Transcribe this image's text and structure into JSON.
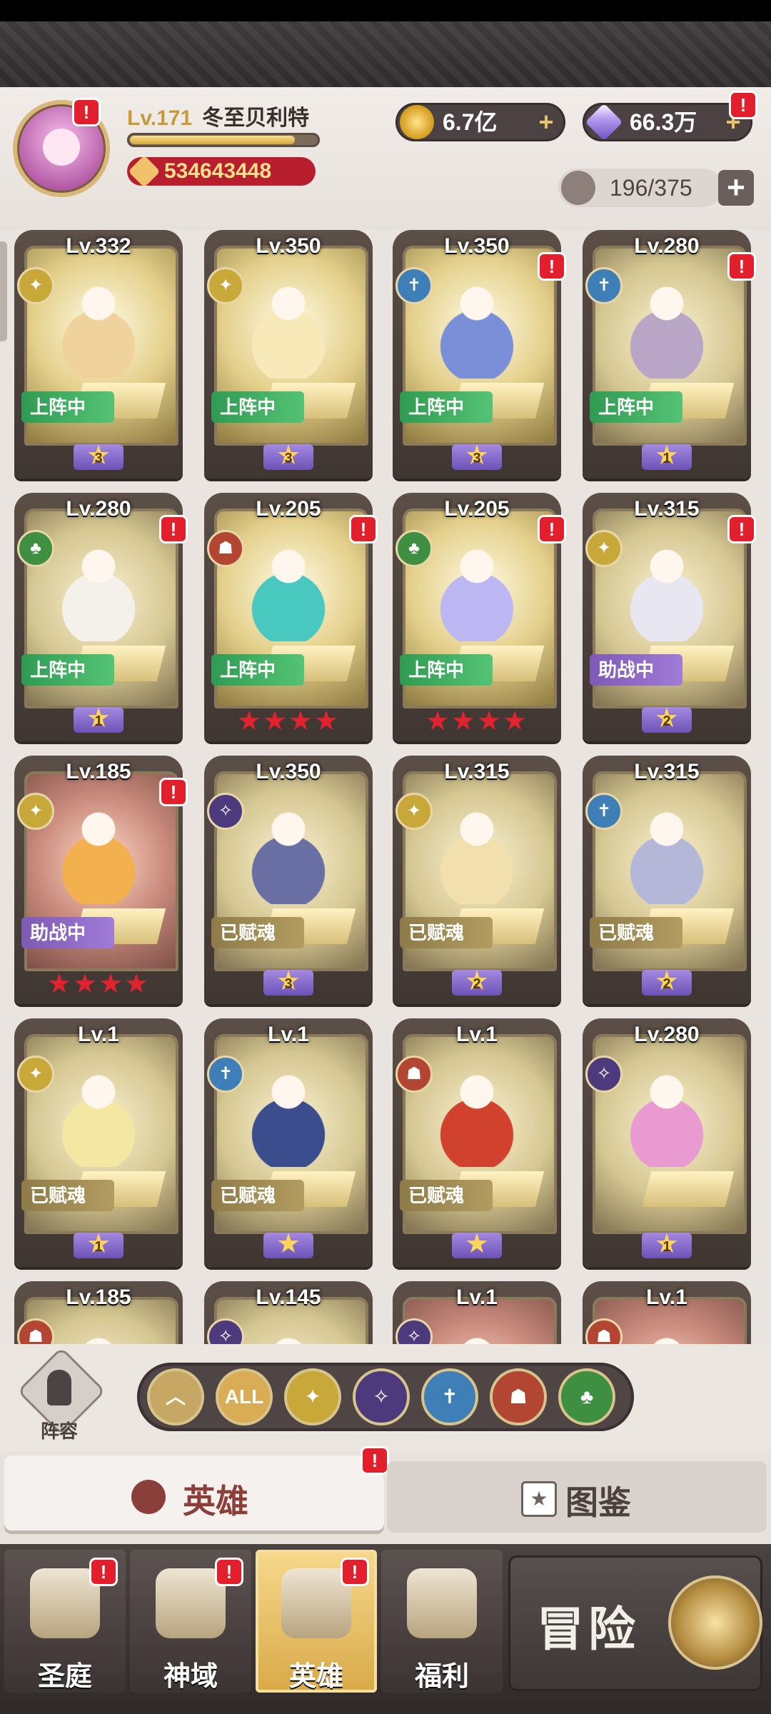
{
  "player": {
    "level": "Lv.171",
    "name": "冬至贝利特",
    "power": "534643448",
    "xp_fraction": 0.88
  },
  "currencies": {
    "gold": "6.7亿",
    "gems": "66.3万",
    "hero_capacity": "196/375"
  },
  "heroes": [
    {
      "level": "Lv.332",
      "status": "上阵中",
      "star_type": "purple",
      "stars": "3",
      "faction": "light",
      "badge": false,
      "tint": "gold",
      "hero_color": "#f0d39c"
    },
    {
      "level": "Lv.350",
      "status": "上阵中",
      "star_type": "purple",
      "stars": "3",
      "faction": "light",
      "badge": false,
      "tint": "gold",
      "hero_color": "#f7e9b8"
    },
    {
      "level": "Lv.350",
      "status": "上阵中",
      "star_type": "purple",
      "stars": "3",
      "faction": "holy",
      "badge": true,
      "tint": "gold",
      "hero_color": "#7a8fd8"
    },
    {
      "level": "Lv.280",
      "status": "上阵中",
      "star_type": "purple",
      "stars": "1",
      "faction": "holy",
      "badge": true,
      "tint": "normal",
      "hero_color": "#b9a6c7"
    },
    {
      "level": "Lv.280",
      "status": "上阵中",
      "star_type": "purple",
      "stars": "1",
      "faction": "nature",
      "badge": true,
      "tint": "normal",
      "hero_color": "#f4f1ea"
    },
    {
      "level": "Lv.205",
      "status": "上阵中",
      "star_type": "red",
      "stars": "★★★★",
      "faction": "beast",
      "badge": true,
      "tint": "gold",
      "hero_color": "#49c8bf"
    },
    {
      "level": "Lv.205",
      "status": "上阵中",
      "star_type": "red",
      "stars": "★★★★",
      "faction": "nature",
      "badge": true,
      "tint": "gold",
      "hero_color": "#bcb6f2"
    },
    {
      "level": "Lv.315",
      "status": "助战中",
      "star_type": "purple",
      "stars": "2",
      "faction": "light",
      "badge": true,
      "tint": "normal",
      "hero_color": "#e8e6f1"
    },
    {
      "level": "Lv.185",
      "status": "助战中",
      "star_type": "red",
      "stars": "★★★★",
      "faction": "light",
      "badge": true,
      "tint": "red",
      "hero_color": "#f3b04e"
    },
    {
      "level": "Lv.350",
      "status": "已赋魂",
      "star_type": "purple",
      "stars": "3",
      "faction": "dark",
      "badge": false,
      "tint": "normal",
      "hero_color": "#6a6fa3"
    },
    {
      "level": "Lv.315",
      "status": "已赋魂",
      "star_type": "purple",
      "stars": "2",
      "faction": "light",
      "badge": false,
      "tint": "normal",
      "hero_color": "#f2dfae"
    },
    {
      "level": "Lv.315",
      "status": "已赋魂",
      "star_type": "purple",
      "stars": "2",
      "faction": "holy",
      "badge": false,
      "tint": "normal",
      "hero_color": "#b5b7d9"
    },
    {
      "level": "Lv.1",
      "status": "已赋魂",
      "star_type": "purple",
      "stars": "1",
      "faction": "light",
      "badge": false,
      "tint": "normal",
      "hero_color": "#f4e7a3"
    },
    {
      "level": "Lv.1",
      "status": "已赋魂",
      "star_type": "purple",
      "stars": "★",
      "faction": "holy",
      "badge": false,
      "tint": "normal",
      "hero_color": "#3b4d8d"
    },
    {
      "level": "Lv.1",
      "status": "已赋魂",
      "star_type": "purple",
      "stars": "★",
      "faction": "beast",
      "badge": false,
      "tint": "normal",
      "hero_color": "#d0412e"
    },
    {
      "level": "Lv.280",
      "status": "",
      "star_type": "purple",
      "stars": "1",
      "faction": "dark",
      "badge": false,
      "tint": "normal",
      "hero_color": "#e99ad0"
    },
    {
      "level": "Lv.185",
      "status": "",
      "star_type": "",
      "stars": "",
      "faction": "beast",
      "badge": false,
      "tint": "normal",
      "hero_color": "#d9c9b1"
    },
    {
      "level": "Lv.145",
      "status": "",
      "star_type": "",
      "stars": "",
      "faction": "dark",
      "badge": false,
      "tint": "normal",
      "hero_color": "#6b5b5b"
    },
    {
      "level": "Lv.1",
      "status": "",
      "star_type": "",
      "stars": "",
      "faction": "dark",
      "badge": false,
      "tint": "red",
      "hero_color": "#2b3152"
    },
    {
      "level": "Lv.1",
      "status": "",
      "star_type": "",
      "stars": "",
      "faction": "beast",
      "badge": false,
      "tint": "red",
      "hero_color": "#8e5f54"
    }
  ],
  "lineup_label": "阵容",
  "filters": [
    {
      "id": "up",
      "label": "︿",
      "color": "#c7a764"
    },
    {
      "id": "all",
      "label": "ALL",
      "color": "#d8ad55"
    },
    {
      "id": "light",
      "label": "✦",
      "color": "#c9a83a"
    },
    {
      "id": "dark",
      "label": "✧",
      "color": "#4c3a7d"
    },
    {
      "id": "holy",
      "label": "✝",
      "color": "#3e7fb7"
    },
    {
      "id": "beast",
      "label": "☗",
      "color": "#b24632"
    },
    {
      "id": "nature",
      "label": "♣",
      "color": "#3f8f43"
    }
  ],
  "tabs": {
    "heroes": "英雄",
    "codex": "图鉴"
  },
  "nav": [
    {
      "label": "圣庭",
      "badge": true
    },
    {
      "label": "神域",
      "badge": true
    },
    {
      "label": "英雄",
      "badge": true,
      "active": true
    },
    {
      "label": "福利",
      "badge": false
    }
  ],
  "adventure_label": "冒险",
  "badge_symbol": "!",
  "faction_colors": {
    "light": "#c9a83a",
    "holy": "#3e7fb7",
    "nature": "#3f8f43",
    "beast": "#b24632",
    "dark": "#4c3a7d"
  }
}
